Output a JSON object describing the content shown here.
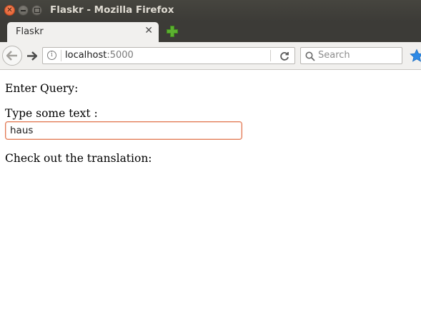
{
  "window": {
    "title": "Flaskr - Mozilla Firefox",
    "close_icon": "close-icon",
    "minimize_icon": "minimize-icon",
    "maximize_icon": "maximize-icon"
  },
  "tabs": [
    {
      "label": "Flaskr",
      "close_glyph": "✕"
    }
  ],
  "toolbar": {
    "url_host": "localhost",
    "url_port": ":5000",
    "search_placeholder": "Search"
  },
  "page": {
    "heading": "Enter Query:",
    "input_label": "Type some text :",
    "input_value": "haus",
    "result_heading": "Check out the translation:"
  },
  "colors": {
    "accent_bookmark": "#2e8ae6",
    "input_focus_border": "#e27a55",
    "new_tab_green": "#5cb030"
  }
}
